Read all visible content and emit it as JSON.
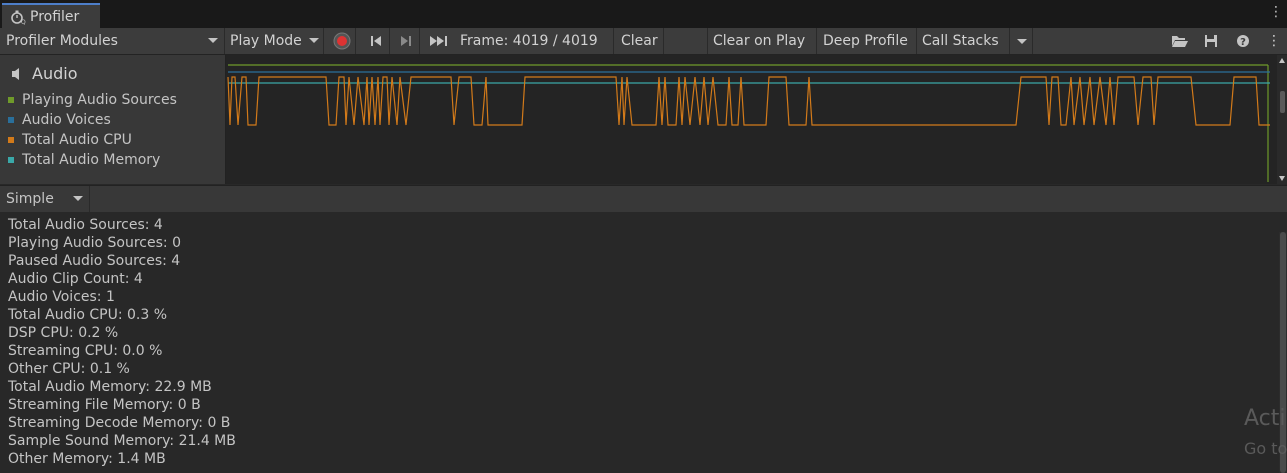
{
  "window": {
    "tab_title": "Profiler"
  },
  "toolbar": {
    "modules_label": "Profiler Modules",
    "play_mode_label": "Play Mode",
    "frame_label": "Frame: 4019 / 4019",
    "clear_label": "Clear",
    "clear_on_play_label": "Clear on Play",
    "deep_profile_label": "Deep Profile",
    "call_stacks_label": "Call Stacks"
  },
  "module": {
    "title": "Audio",
    "legend": [
      {
        "label": "Playing Audio Sources",
        "color": "#6f9a2a"
      },
      {
        "label": "Audio Voices",
        "color": "#2a6f9a"
      },
      {
        "label": "Total Audio CPU",
        "color": "#d27a1a"
      },
      {
        "label": "Total Audio Memory",
        "color": "#3aa8a8"
      }
    ]
  },
  "detail": {
    "view_mode": "Simple"
  },
  "stats": [
    "Total Audio Sources: 4",
    "Playing Audio Sources: 0",
    "Paused Audio Sources: 4",
    "Audio Clip Count: 4",
    "Audio Voices: 1",
    "Total Audio CPU: 0.3 %",
    "DSP CPU: 0.2 %",
    "Streaming CPU: 0.0 %",
    "Other CPU: 0.1 %",
    "Total Audio Memory: 22.9 MB",
    "Streaming File Memory: 0 B",
    "Streaming Decode Memory: 0 B",
    "Sample Sound Memory: 21.4 MB",
    "Other Memory: 1.4 MB"
  ],
  "watermark": {
    "line1": "Acti",
    "line2": "Go to"
  }
}
